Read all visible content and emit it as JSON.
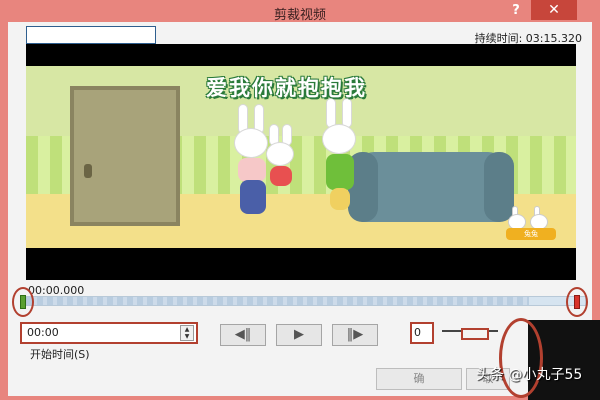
{
  "window": {
    "title": "剪裁视频",
    "help_label": "?",
    "close_label": "✕"
  },
  "header": {
    "name_value": "",
    "duration_label": "持续时间: 03:15.320"
  },
  "video": {
    "caption": "爱我你就抱抱我",
    "logo_text": "兔兔"
  },
  "timeline": {
    "current_time": "00:00.000",
    "progress": 0.9
  },
  "start": {
    "value": "00:00",
    "label": "开始时间(S)",
    "spin_up": "▲",
    "spin_down": "▼"
  },
  "controls": {
    "prev_frame": "◀‖",
    "play": "▶",
    "next_frame": "‖▶"
  },
  "end": {
    "value": "0"
  },
  "footer": {
    "ok_label": "确",
    "cancel_label": "取"
  },
  "watermark": "头条 @小丸子55",
  "colors": {
    "window_frame": "#e8857e",
    "highlight_marks": "#b2402f",
    "start_marker": "#5aa030",
    "end_marker": "#d8332a"
  }
}
